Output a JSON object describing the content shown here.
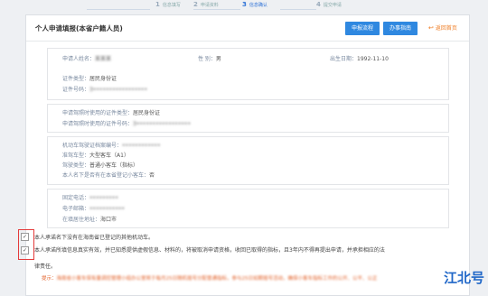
{
  "steps": [
    {
      "num": "1",
      "label": "信息填写"
    },
    {
      "num": "2",
      "label": "申请资料"
    },
    {
      "num": "3",
      "label": "信息确认"
    },
    {
      "num": "4",
      "label": "提交申请"
    }
  ],
  "header": {
    "title": "个人申请填报(本省户籍人员)",
    "btn_progress": "申报流程",
    "btn_guide": "办事指南",
    "btn_back": "返回首页",
    "back_icon": "return-icon"
  },
  "applicant": {
    "name_label": "申请人姓名：",
    "name_value": "某某某",
    "gender_label": "性 别：",
    "gender_value": "男",
    "birth_label": "出生日期：",
    "birth_value": "1992-11-10",
    "id_type_label": "证件类型：",
    "id_type_value": "居民身份证",
    "id_no_label": "证件号码：",
    "id_no_value": "3•••••••••••••••••"
  },
  "license": {
    "type_label": "申请驾照时使用的证件类型：",
    "type_value": "居民身份证",
    "no_label": "申请驾照时使用的证件号码：",
    "no_value": "3•••••••••••••••••"
  },
  "vehicle": {
    "archive_label": "机动车驾驶证档案编号：",
    "archive_value": "••••••••••••",
    "model_label": "准驾车型：",
    "model_value": "大型客车（A1）",
    "class_label": "驾驶类型：",
    "class_value": "普通小客车（指标）",
    "owned_label": "本人名下是否有在本省登记小客车：",
    "owned_value": "否"
  },
  "contact": {
    "phone_label": "固定电话：",
    "phone_value": "•••••••••",
    "mobile_label": "电子邮箱：",
    "mobile_value": "•••••••••••",
    "address_label": "在填居住地址：",
    "address_value": "海口市"
  },
  "statements": {
    "s1": "本人承诺名下没有在海南省已登记的其他机动车。",
    "s2": "本人承诺所填信息真实有效，并已知悉提供虚假信息、材料的，将被取消申请资格，收回已取得的指标，且3年内不得再提出申请，并承担相应的法",
    "s2_cont": "律责任。"
  },
  "tip": {
    "label": "提示：",
    "text": "海南省小客车保有量调控管理小组办公室将于每月25日随机摇号分配普通指标，参与25日如期摇号活动，确保小客车指标工作的公开、公平、公正"
  },
  "watermark": "江北号"
}
